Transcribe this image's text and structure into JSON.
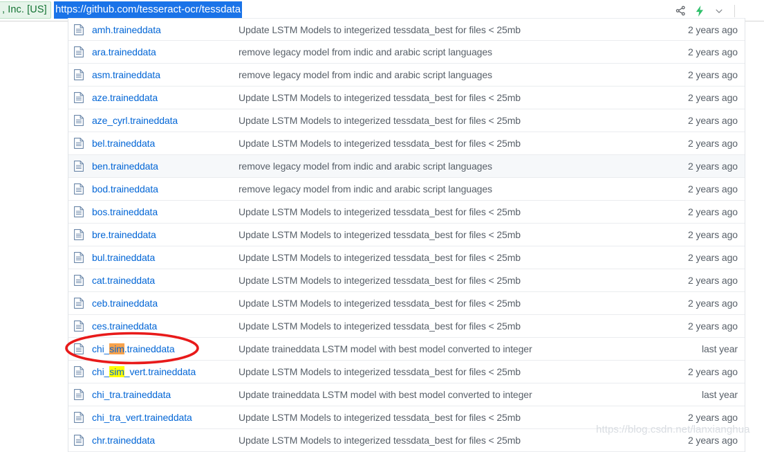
{
  "browser": {
    "cert_badge_text": ", Inc. [US]",
    "url": "https://github.com/tesseract-ocr/tessdata",
    "icons": {
      "share": "share-icon",
      "flash": "lightning-bolt-icon",
      "chevron": "chevron-down-icon"
    },
    "accent_selection_color": "#1a73e8",
    "cert_color": "#137333",
    "flash_color": "#2fc06b"
  },
  "table": {
    "rows": [
      {
        "name": "amh.traineddata",
        "message": "Update LSTM Models to integerized tessdata_best for files < 25mb",
        "time": "2 years ago",
        "hovered": false
      },
      {
        "name": "ara.traineddata",
        "message": "remove legacy model from indic and arabic script languages",
        "time": "2 years ago",
        "hovered": false
      },
      {
        "name": "asm.traineddata",
        "message": "remove legacy model from indic and arabic script languages",
        "time": "2 years ago",
        "hovered": false
      },
      {
        "name": "aze.traineddata",
        "message": "Update LSTM Models to integerized tessdata_best for files < 25mb",
        "time": "2 years ago",
        "hovered": false
      },
      {
        "name": "aze_cyrl.traineddata",
        "message": "Update LSTM Models to integerized tessdata_best for files < 25mb",
        "time": "2 years ago",
        "hovered": false
      },
      {
        "name": "bel.traineddata",
        "message": "Update LSTM Models to integerized tessdata_best for files < 25mb",
        "time": "2 years ago",
        "hovered": false
      },
      {
        "name": "ben.traineddata",
        "message": "remove legacy model from indic and arabic script languages",
        "time": "2 years ago",
        "hovered": true
      },
      {
        "name": "bod.traineddata",
        "message": "remove legacy model from indic and arabic script languages",
        "time": "2 years ago",
        "hovered": false
      },
      {
        "name": "bos.traineddata",
        "message": "Update LSTM Models to integerized tessdata_best for files < 25mb",
        "time": "2 years ago",
        "hovered": false
      },
      {
        "name": "bre.traineddata",
        "message": "Update LSTM Models to integerized tessdata_best for files < 25mb",
        "time": "2 years ago",
        "hovered": false
      },
      {
        "name": "bul.traineddata",
        "message": "Update LSTM Models to integerized tessdata_best for files < 25mb",
        "time": "2 years ago",
        "hovered": false
      },
      {
        "name": "cat.traineddata",
        "message": "Update LSTM Models to integerized tessdata_best for files < 25mb",
        "time": "2 years ago",
        "hovered": false
      },
      {
        "name": "ceb.traineddata",
        "message": "Update LSTM Models to integerized tessdata_best for files < 25mb",
        "time": "2 years ago",
        "hovered": false
      },
      {
        "name": "ces.traineddata",
        "message": "Update LSTM Models to integerized tessdata_best for files < 25mb",
        "time": "2 years ago",
        "hovered": false
      },
      {
        "name": "chi_sim.traineddata",
        "name_parts": [
          {
            "t": "chi_",
            "hl": "none"
          },
          {
            "t": "sim",
            "hl": "orange"
          },
          {
            "t": ".traineddata",
            "hl": "none"
          }
        ],
        "message": "Update traineddata LSTM model with best model converted to integer",
        "time": "last year",
        "hovered": false
      },
      {
        "name": "chi_sim_vert.traineddata",
        "name_parts": [
          {
            "t": "chi_",
            "hl": "none"
          },
          {
            "t": "sim",
            "hl": "yellow"
          },
          {
            "t": "_vert.traineddata",
            "hl": "none"
          }
        ],
        "message": "Update LSTM Models to integerized tessdata_best for files < 25mb",
        "time": "2 years ago",
        "hovered": false
      },
      {
        "name": "chi_tra.traineddata",
        "message": "Update traineddata LSTM model with best model converted to integer",
        "time": "last year",
        "hovered": false
      },
      {
        "name": "chi_tra_vert.traineddata",
        "message": "Update LSTM Models to integerized tessdata_best for files < 25mb",
        "time": "2 years ago",
        "hovered": false
      },
      {
        "name": "chr.traineddata",
        "message": "Update LSTM Models to integerized tessdata_best for files < 25mb",
        "time": "2 years ago",
        "hovered": false
      }
    ]
  },
  "annotation": {
    "type": "ellipse",
    "color": "#e81a1a",
    "target": "chi_sim.traineddata"
  },
  "watermark": {
    "text": "https://blog.csdn.net/lanxianghua"
  }
}
